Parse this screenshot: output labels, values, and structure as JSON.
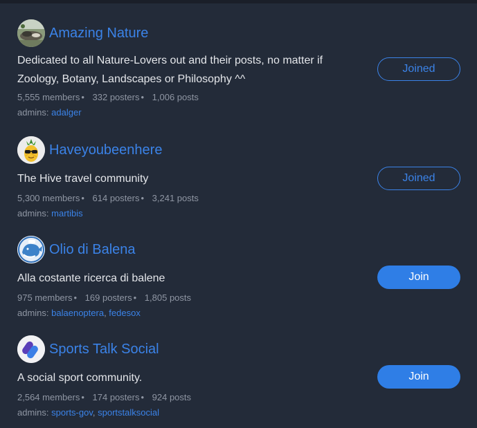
{
  "accent_color": "#3b83e8",
  "communities": [
    {
      "title": "Amazing Nature",
      "avatar_icon": "nature-photo-icon",
      "description": "Dedicated to all Nature-Lovers out and their posts, no matter if Zoology, Botany, Landscapes or Philosophy ^^",
      "members": "5,555 members",
      "posters": "332 posters",
      "posts": "1,006 posts",
      "admins_label": "admins:",
      "admins": [
        "adalger"
      ],
      "button_label": "Joined"
    },
    {
      "title": "Haveyoubeenhere",
      "avatar_icon": "pineapple-sunglasses-icon",
      "description": "The Hive travel community",
      "members": "5,300 members",
      "posters": "614 posters",
      "posts": "3,241 posts",
      "admins_label": "admins:",
      "admins": [
        "martibis"
      ],
      "button_label": "Joined"
    },
    {
      "title": "Olio di Balena",
      "avatar_icon": "whale-icon",
      "description": "Alla costante ricerca di balene",
      "members": "975 members",
      "posters": "169 posters",
      "posts": "1,805 posts",
      "admins_label": "admins:",
      "admins": [
        "balaenoptera",
        "fedesox"
      ],
      "button_label": "Join"
    },
    {
      "title": "Sports Talk Social",
      "avatar_icon": "sports-talk-logo-icon",
      "description": "A social sport community.",
      "members": "2,564 members",
      "posters": "174 posters",
      "posts": "924 posts",
      "admins_label": "admins:",
      "admins": [
        "sports-gov",
        "sportstalksocial"
      ],
      "button_label": "Join"
    }
  ]
}
